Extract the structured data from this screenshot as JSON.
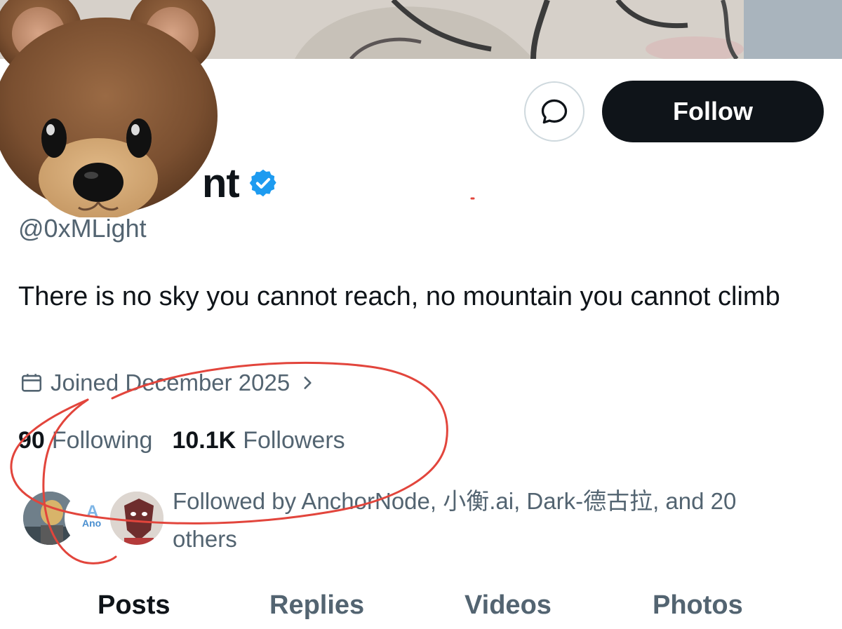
{
  "profile": {
    "display_name_visible": "nt",
    "handle": "@0xMLight",
    "bio": "There is no sky you cannot reach, no mountain you cannot climb",
    "joined": "Joined December 2025",
    "verified": true,
    "avatar_icon": "bear-face-icon"
  },
  "actions": {
    "message_icon": "message-bubble-icon",
    "follow_label": "Follow"
  },
  "stats": {
    "following_count": "90",
    "following_label": "Following",
    "followers_count": "10.1K",
    "followers_label": "Followers"
  },
  "followed_by": {
    "text": "Followed by AnchorNode, 小衡.ai, Dark-德古拉, and 20 others"
  },
  "tabs": [
    {
      "label": "Posts",
      "active": true
    },
    {
      "label": "Replies",
      "active": false
    },
    {
      "label": "Videos",
      "active": false
    },
    {
      "label": "Photos",
      "active": false
    }
  ],
  "colors": {
    "accent_verified": "#1d9bf0",
    "follow_bg": "#0f1419",
    "muted_text": "#536471",
    "annotation_red": "#e2453c"
  }
}
